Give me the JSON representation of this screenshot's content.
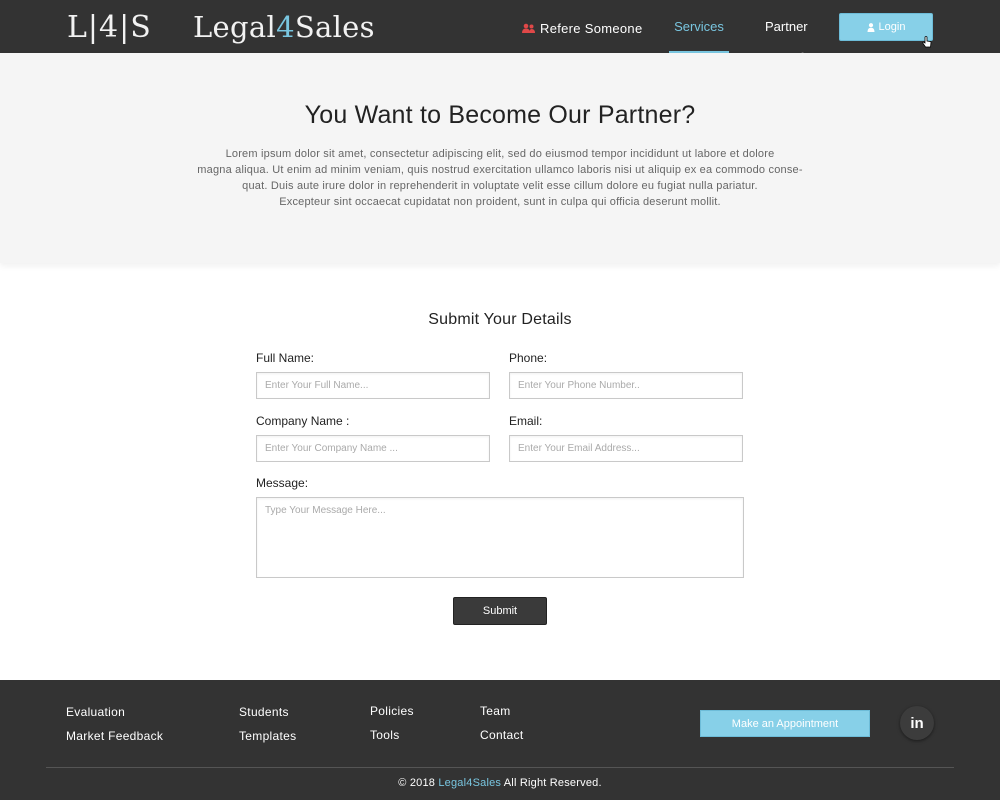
{
  "header": {
    "logo_mark": "L|4|S",
    "logo_text_prefix": "Legal",
    "logo_text_accent": "4",
    "logo_text_suffix": "Sales",
    "nav": {
      "refer": "Refere Someone",
      "services": "Services",
      "partner": "Partner"
    },
    "login_label": "Login"
  },
  "hero": {
    "title": "You Want to Become Our Partner?",
    "description_lines": [
      "Lorem ipsum dolor sit amet, consectetur adipiscing elit, sed do eiusmod tempor incididunt ut labore et dolore",
      "magna aliqua. Ut enim ad minim veniam, quis nostrud exercitation ullamco laboris nisi ut aliquip ex ea commodo conse-",
      "quat. Duis aute irure dolor in reprehenderit in voluptate velit esse cillum dolore eu fugiat nulla pariatur.",
      "Excepteur sint occaecat cupidatat non proident, sunt in culpa qui officia deserunt mollit."
    ]
  },
  "form": {
    "title": "Submit Your Details",
    "full_name": {
      "label": "Full Name:",
      "placeholder": "Enter Your Full Name..."
    },
    "phone": {
      "label": "Phone:",
      "placeholder": "Enter Your Phone Number.."
    },
    "company": {
      "label": "Company Name :",
      "placeholder": "Enter Your Company Name ..."
    },
    "email": {
      "label": "Email:",
      "placeholder": "Enter Your Email Address..."
    },
    "message": {
      "label": "Message:",
      "placeholder": "Type Your Message Here..."
    },
    "submit_label": "Submit"
  },
  "footer": {
    "col1": [
      "Evaluation",
      "Market Feedback"
    ],
    "col2": [
      "Students",
      "Templates"
    ],
    "col3": [
      "Policies",
      "Tools"
    ],
    "col4": [
      "Team",
      "Contact"
    ],
    "appointment_label": "Make an Appointment",
    "linkedin_label": "in",
    "copyright_prefix": "© 2018 ",
    "copyright_brand": "Legal4Sales",
    "copyright_suffix": " All Right Reserved."
  },
  "colors": {
    "header_bg": "#333333",
    "accent": "#79c6e0",
    "button_blue": "#87d0e8",
    "hero_bg": "#f5f5f5",
    "refer_icon": "#e04848"
  },
  "icons": {
    "refer": "users-icon",
    "login": "user-icon",
    "social": "linkedin-icon"
  }
}
